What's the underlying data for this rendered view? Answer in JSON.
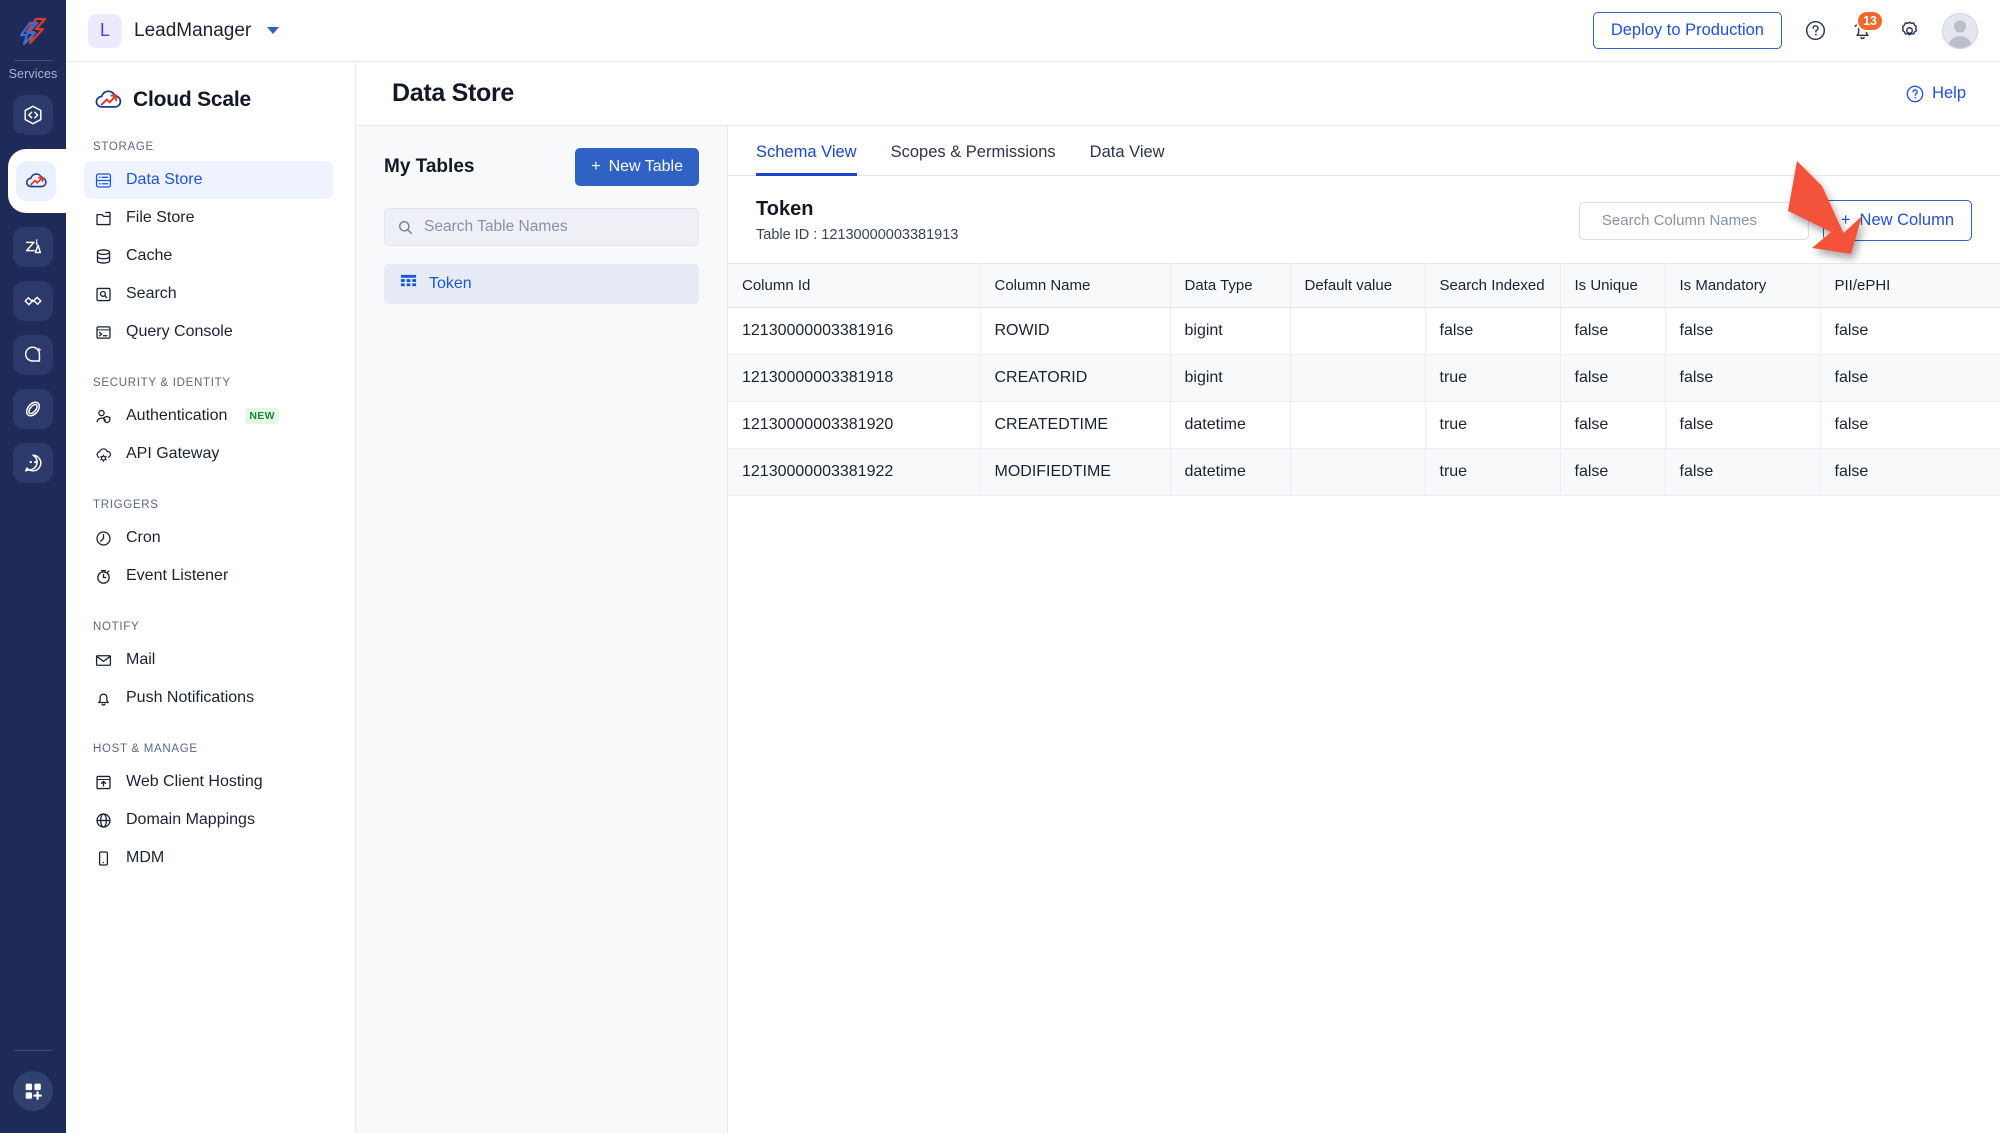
{
  "topbar": {
    "app_initial": "L",
    "app_name": "LeadManager",
    "deploy_label": "Deploy to Production",
    "notification_count": "13",
    "icons": [
      "help-circle-icon",
      "bell-icon",
      "gear-icon",
      "user-avatar"
    ]
  },
  "brand": {
    "name": "Cloud Scale",
    "icon": "cloud-scale-logo"
  },
  "rail": {
    "label": "Services",
    "items": [
      {
        "name": "catalyst-code-icon"
      },
      {
        "name": "cloud-scale-icon",
        "active": true
      },
      {
        "name": "zia-icon"
      },
      {
        "name": "connectors-icon"
      },
      {
        "name": "quickml-icon"
      },
      {
        "name": "slate-icon"
      },
      {
        "name": "chat-bot-icon"
      }
    ],
    "bottom": {
      "name": "app-grid-add-icon"
    }
  },
  "nav": {
    "sections": [
      {
        "label": "STORAGE",
        "items": [
          {
            "label": "Data Store",
            "icon": "database-rows-icon",
            "active": true
          },
          {
            "label": "File Store",
            "icon": "folder-icon",
            "active": false
          },
          {
            "label": "Cache",
            "icon": "cylinder-icon",
            "active": false
          },
          {
            "label": "Search",
            "icon": "search-square-icon",
            "active": false
          },
          {
            "label": "Query Console",
            "icon": "terminal-icon",
            "active": false
          }
        ]
      },
      {
        "label": "SECURITY & IDENTITY",
        "items": [
          {
            "label": "Authentication",
            "icon": "user-shield-icon",
            "active": false,
            "badge": "NEW"
          },
          {
            "label": "API Gateway",
            "icon": "cloud-gear-icon",
            "active": false
          }
        ]
      },
      {
        "label": "TRIGGERS",
        "items": [
          {
            "label": "Cron",
            "icon": "clock-icon",
            "active": false
          },
          {
            "label": "Event Listener",
            "icon": "stopwatch-icon",
            "active": false
          }
        ]
      },
      {
        "label": "NOTIFY",
        "items": [
          {
            "label": "Mail",
            "icon": "envelope-icon",
            "active": false
          },
          {
            "label": "Push Notifications",
            "icon": "bell-icon",
            "active": false
          }
        ]
      },
      {
        "label": "HOST & MANAGE",
        "items": [
          {
            "label": "Web Client Hosting",
            "icon": "window-upload-icon",
            "active": false
          },
          {
            "label": "Domain Mappings",
            "icon": "globe-icon",
            "active": false
          },
          {
            "label": "MDM",
            "icon": "mobile-icon",
            "active": false
          }
        ]
      }
    ]
  },
  "page": {
    "title": "Data Store",
    "help_label": "Help"
  },
  "tables_pane": {
    "title": "My Tables",
    "new_table_label": "New Table",
    "search_placeholder": "Search Table Names",
    "search_value": "",
    "items": [
      {
        "label": "Token",
        "icon": "grid-table-icon",
        "selected": true
      }
    ]
  },
  "detail": {
    "tabs": [
      {
        "label": "Schema View",
        "active": true
      },
      {
        "label": "Scopes & Permissions",
        "active": false
      },
      {
        "label": "Data View",
        "active": false
      }
    ],
    "table_name": "Token",
    "table_id_label": "Table ID : 12130000003381913",
    "column_search_placeholder": "Search Column Names",
    "column_search_value": "",
    "new_column_label": "New Column",
    "columns": [
      "Column Id",
      "Column Name",
      "Data Type",
      "Default value",
      "Search Indexed",
      "Is Unique",
      "Is Mandatory",
      "PII/ePHI"
    ],
    "rows": [
      [
        "12130000003381916",
        "ROWID",
        "bigint",
        "",
        "false",
        "false",
        "false",
        "false"
      ],
      [
        "12130000003381918",
        "CREATORID",
        "bigint",
        "",
        "true",
        "false",
        "false",
        "false"
      ],
      [
        "12130000003381920",
        "CREATEDTIME",
        "datetime",
        "",
        "true",
        "false",
        "false",
        "false"
      ],
      [
        "12130000003381922",
        "MODIFIEDTIME",
        "datetime",
        "",
        "true",
        "false",
        "false",
        "false"
      ]
    ]
  },
  "annotation": {
    "type": "red-arrow",
    "color": "#f2523a",
    "points_to": "New Column"
  },
  "colors": {
    "rail_bg": "#1e2a58",
    "accent_blue": "#2250d8",
    "primary_button": "#2f62c4",
    "active_nav_bg": "#eef3fe",
    "panel_bg": "#f8f9fb",
    "badge_orange": "#f2682a",
    "new_badge_green": "#1b8a3a"
  }
}
